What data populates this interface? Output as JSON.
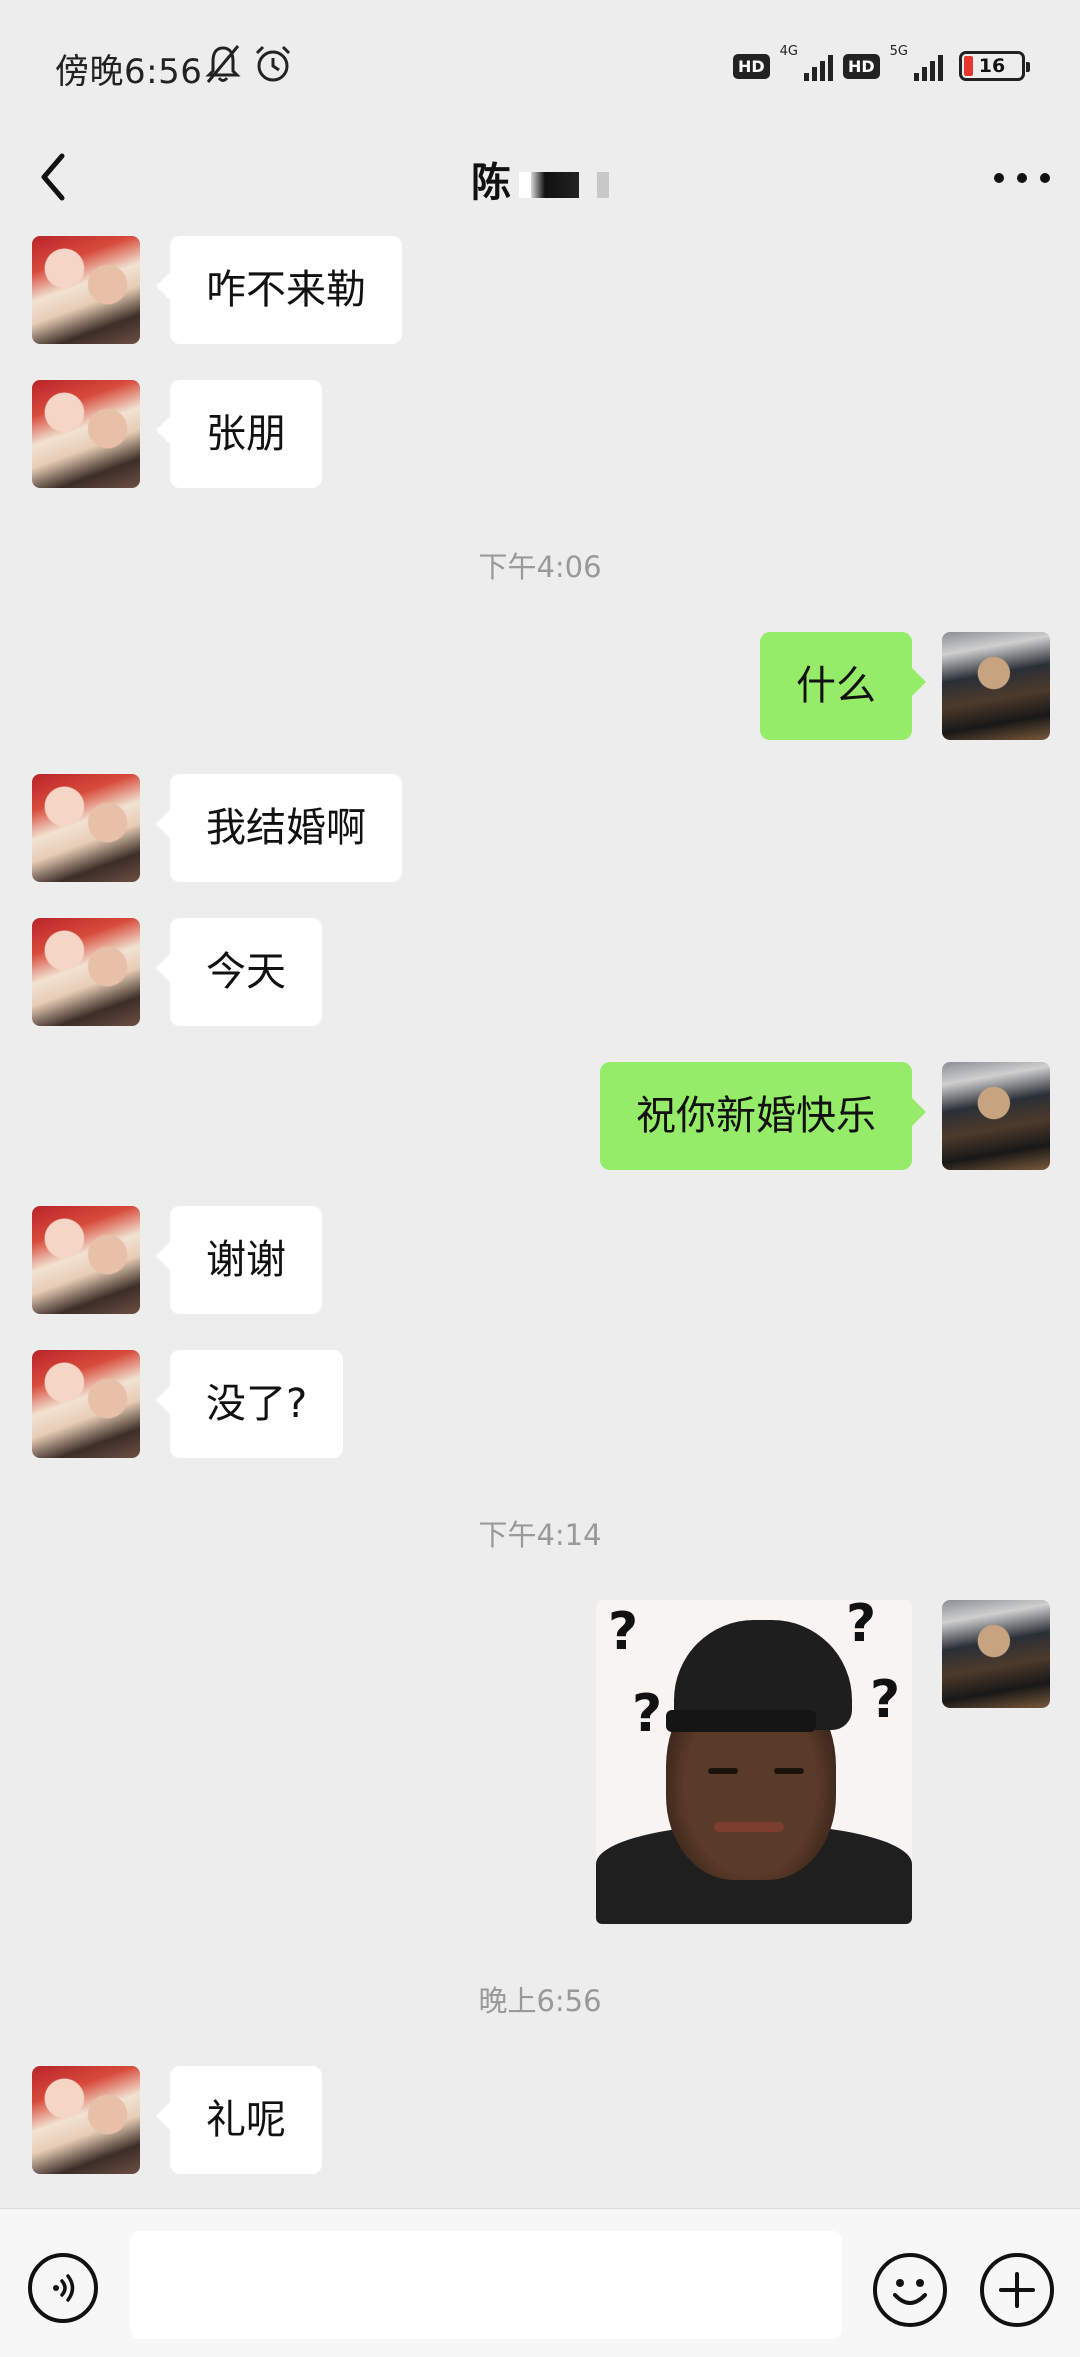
{
  "status_bar": {
    "time": "傍晚6:56",
    "hd_label": "HD",
    "network_1": "4G",
    "network_2": "5G",
    "battery_level": "16",
    "battery_color": "#e5362f",
    "icons": [
      "bell-off-icon",
      "alarm-icon",
      "signal-icon",
      "battery-icon"
    ]
  },
  "header": {
    "title": "陈",
    "back_icon": "chevron-left-icon",
    "more_icon": "more-dots-icon"
  },
  "colors": {
    "background": "#ededed",
    "incoming_bubble": "#ffffff",
    "outgoing_bubble": "#95ec69",
    "timestamp_text": "#999999"
  },
  "messages": [
    {
      "from": "friend",
      "text": "咋不来勒"
    },
    {
      "from": "friend",
      "text": "张朋"
    },
    {
      "timestamp": "下午4:06"
    },
    {
      "from": "self",
      "text": "什么"
    },
    {
      "from": "friend",
      "text": "我结婚啊"
    },
    {
      "from": "friend",
      "text": "今天"
    },
    {
      "from": "self",
      "text": "祝你新婚快乐"
    },
    {
      "from": "friend",
      "text": "谢谢"
    },
    {
      "from": "friend",
      "text": "没了?"
    },
    {
      "timestamp": "下午4:14"
    },
    {
      "from": "self",
      "sticker": "confused-man-question-marks",
      "marks": [
        "?",
        "?",
        "?",
        "?"
      ]
    },
    {
      "timestamp": "晚上6:56"
    },
    {
      "from": "friend",
      "text": "礼呢"
    }
  ],
  "input_bar": {
    "voice_icon": "voice-icon",
    "emoji_icon": "emoji-icon",
    "plus_icon": "plus-icon",
    "value": ""
  }
}
